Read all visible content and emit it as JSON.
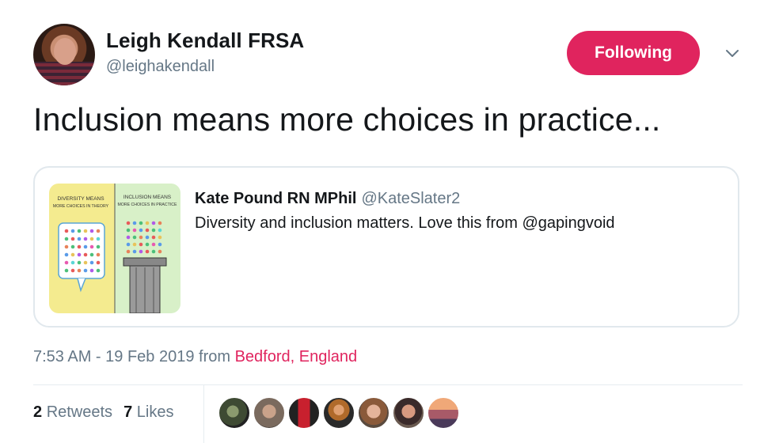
{
  "author": {
    "display_name": "Leigh Kendall FRSA",
    "handle": "@leighakendall",
    "follow_label": "Following"
  },
  "tweet": {
    "text": "Inclusion means more choices in practice...",
    "timestamp": "7:53 AM - 19 Feb 2019 from ",
    "location": "Bedford, England"
  },
  "quoted": {
    "display_name": "Kate Pound RN MPhil",
    "handle": "@KateSlater2",
    "text": "Diversity and inclusion matters. Love this from @gapingvoid",
    "image": {
      "left_caption_1": "DIVERSITY MEANS",
      "left_caption_2": "MORE CHOICES IN THEORY",
      "right_caption_1": "INCLUSION MEANS",
      "right_caption_2": "MORE CHOICES IN PRACTICE"
    }
  },
  "stats": {
    "retweets_count": "2",
    "retweets_label": "Retweets",
    "likes_count": "7",
    "likes_label": "Likes"
  },
  "colors": {
    "accent": "#e0245e",
    "secondary_text": "#657786",
    "border": "#e1e8ed"
  },
  "icons": {
    "caret": "chevron-down-icon"
  }
}
